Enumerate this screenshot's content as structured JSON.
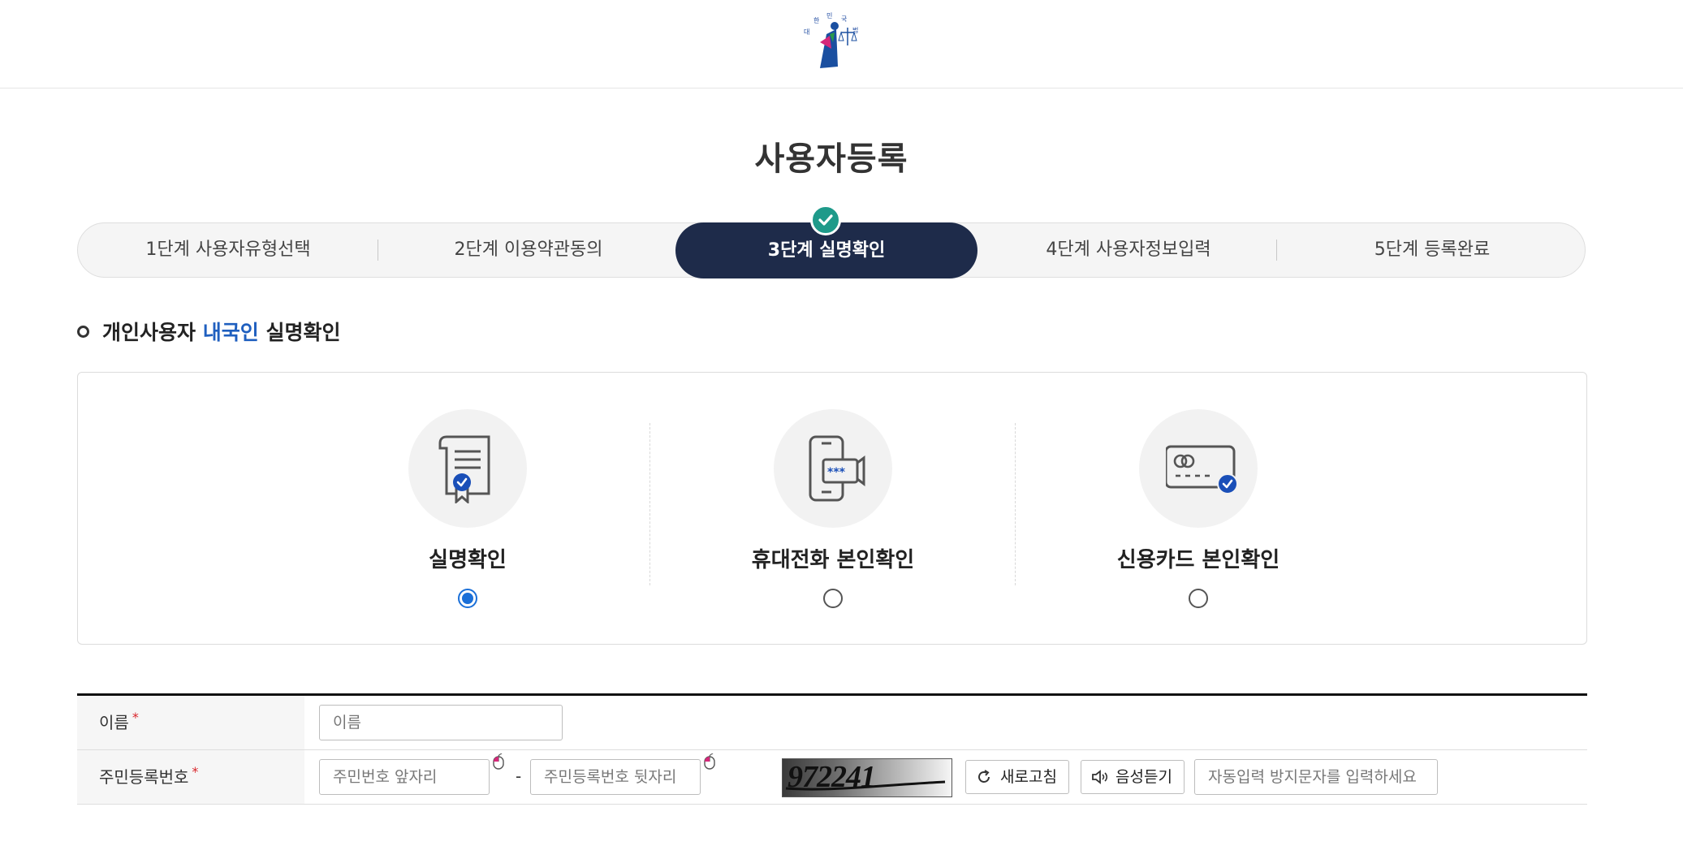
{
  "page": {
    "title": "사용자등록"
  },
  "steps": [
    {
      "label": "1단계 사용자유형선택",
      "active": false
    },
    {
      "label": "2단계 이용약관동의",
      "active": false
    },
    {
      "label": "3단계 실명확인",
      "active": true
    },
    {
      "label": "4단계 사용자정보입력",
      "active": false
    },
    {
      "label": "5단계 등록완료",
      "active": false
    }
  ],
  "section": {
    "prefix": "개인사용자 ",
    "highlight": "내국인",
    "suffix": " 실명확인"
  },
  "methods": [
    {
      "label": "실명확인",
      "icon": "certificate-icon",
      "selected": true
    },
    {
      "label": "휴대전화 본인확인",
      "icon": "mobile-phone-icon",
      "selected": false
    },
    {
      "label": "신용카드 본인확인",
      "icon": "credit-card-icon",
      "selected": false
    }
  ],
  "form": {
    "name_label": "이름",
    "name_placeholder": "이름",
    "rrn_label": "주민등록번호",
    "rrn_front_placeholder": "주민번호 앞자리",
    "rrn_sep": "-",
    "rrn_back_placeholder": "주민등록번호 뒷자리",
    "captcha_text": "972241",
    "refresh_label": "새로고침",
    "audio_label": "음성듣기",
    "captcha_placeholder": "자동입력 방지문자를 입력하세요",
    "required_mark": "*"
  },
  "colors": {
    "navy": "#1e2b4a",
    "accent": "#1f5fbf",
    "radio": "#1a6fd8",
    "check": "#1e9a8a",
    "required": "#d9262c"
  }
}
